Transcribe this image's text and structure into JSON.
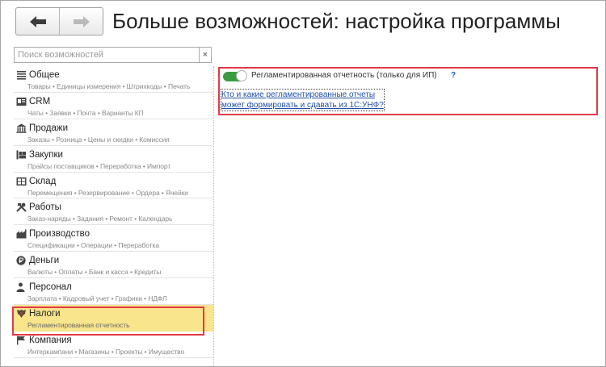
{
  "header": {
    "title": "Больше возможностей: настройка программы",
    "back_icon": "arrow-left-icon",
    "forward_icon": "arrow-right-icon"
  },
  "search": {
    "placeholder": "Поиск возможностей",
    "value": "",
    "clear_label": "×"
  },
  "sidebar": {
    "items": [
      {
        "label": "Общее",
        "sub": "Товары • Единицы измерения • Штрихкоды • Печать",
        "icon": "list-icon",
        "active": false
      },
      {
        "label": "CRM",
        "sub": "Чаты • Заявки • Почта • Варианты КП",
        "icon": "crm-card-icon",
        "active": false
      },
      {
        "label": "Продажи",
        "sub": "Заказы • Розница • Цены и скидки • Комиссия",
        "icon": "storefront-icon",
        "active": false
      },
      {
        "label": "Закупки",
        "sub": "Прайсы поставщиков • Переработка • Импорт",
        "icon": "purchases-icon",
        "active": false
      },
      {
        "label": "Склад",
        "sub": "Перемещения • Резервирование • Ордера • Ячейки",
        "icon": "warehouse-icon",
        "active": false
      },
      {
        "label": "Работы",
        "sub": "Заказ-наряды • Задания • Ремонт • Календарь",
        "icon": "tools-icon",
        "active": false
      },
      {
        "label": "Производство",
        "sub": "Спецификации • Операции • Переработка",
        "icon": "factory-icon",
        "active": false
      },
      {
        "label": "Деньги",
        "sub": "Валюты • Оплаты • Банк и касса • Кредиты",
        "icon": "ruble-coin-icon",
        "active": false
      },
      {
        "label": "Персонал",
        "sub": "Зарплата • Кадровый учет • Графики • НДФЛ",
        "icon": "person-icon",
        "active": false
      },
      {
        "label": "Налоги",
        "sub": "Регламентированная отчетность",
        "icon": "coat-of-arms-icon",
        "active": true
      },
      {
        "label": "Компания",
        "sub": "Интеркампани • Магазины • Проекты • Имущество",
        "icon": "flag-icon",
        "active": false
      }
    ]
  },
  "content": {
    "option_label": "Регламентированная отчетность (только для ИП)",
    "option_enabled": true,
    "help": "?",
    "link_line1": "Кто и какие регламентированные отчеты",
    "link_line2": "может формировать и сдавать из 1С:УНФ?"
  },
  "colors": {
    "highlight_border": "#e23a45",
    "active_bg": "#f8e58c",
    "toggle_on": "#3a9b43",
    "link": "#1f4fa8"
  }
}
